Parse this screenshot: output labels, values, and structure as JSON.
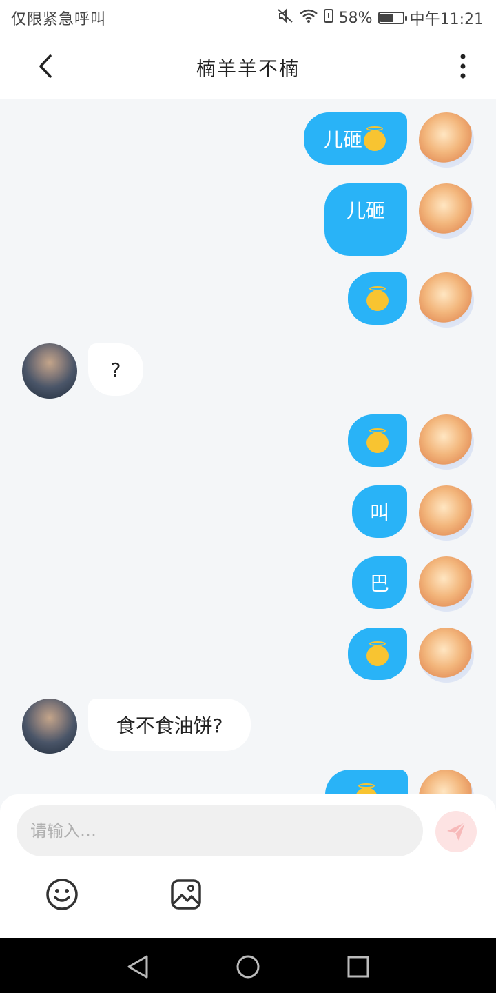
{
  "status_bar": {
    "carrier": "仅限紧急呼叫",
    "battery": "58%",
    "battery_level": 0.58,
    "time": "中午11:21"
  },
  "header": {
    "title": "楠羊羊不楠"
  },
  "messages": [
    {
      "side": "self",
      "text": "儿砸",
      "emoji": "smiling-face-with-halo"
    },
    {
      "side": "self",
      "text": "儿砸"
    },
    {
      "side": "self",
      "text": "",
      "emoji": "smiling-face-with-halo"
    },
    {
      "side": "other",
      "text": "?"
    },
    {
      "side": "self",
      "text": "",
      "emoji": "smiling-face-with-halo"
    },
    {
      "side": "self",
      "text": "叫"
    },
    {
      "side": "self",
      "text": "巴"
    },
    {
      "side": "self",
      "text": "",
      "emoji": "smiling-face-with-halo"
    },
    {
      "side": "other",
      "text": "食不食油饼?"
    },
    {
      "side": "self",
      "text": "",
      "emoji": "smiling-face-with-halo"
    }
  ],
  "composer": {
    "placeholder": "请输入…",
    "send_icon": "send-icon",
    "tools": [
      "smiley-icon",
      "image-icon"
    ]
  },
  "nav_bar": {
    "buttons": [
      "back-triangle-icon",
      "home-circle-icon",
      "recents-square-icon"
    ]
  },
  "colors": {
    "bubble_self": "#29b3f7",
    "bubble_other": "#ffffff",
    "chat_background": "#f4f6f8",
    "send_button": "#fde3e3"
  }
}
